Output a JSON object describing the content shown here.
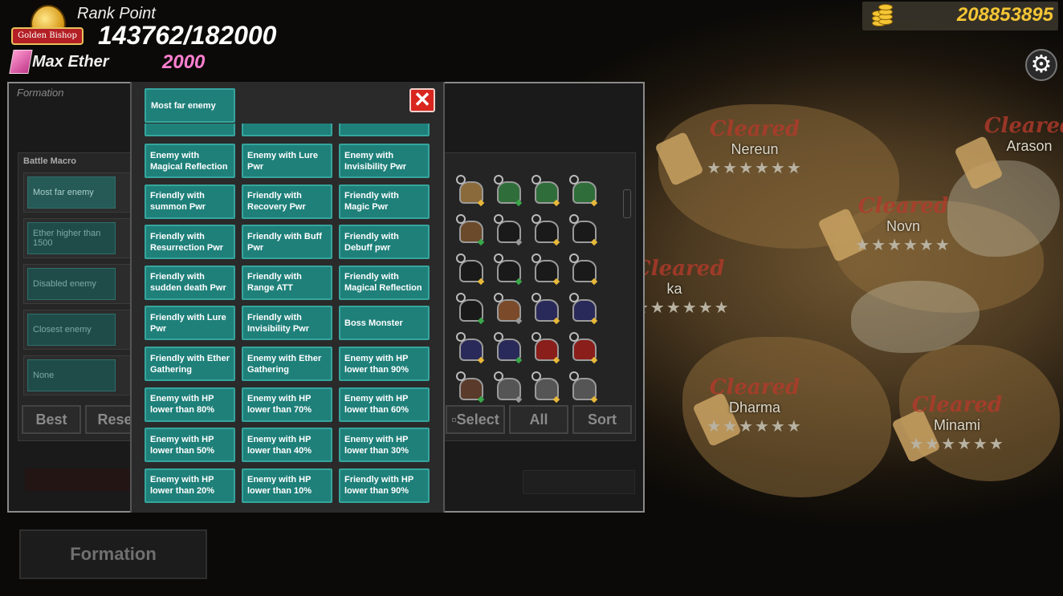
{
  "hud": {
    "badge_text": "Golden Bishop",
    "rank_label": "Rank Point",
    "rank_value": "143762/182000",
    "ether_label": "Max Ether",
    "ether_value": "2000",
    "gold_value": "208853895",
    "gold_icon": "gold-coins-icon",
    "settings_icon": "gear-icon"
  },
  "map": {
    "regions": [
      {
        "name": "Nereun",
        "status": "Cleared"
      },
      {
        "name": "Arason",
        "status": "Cleared"
      },
      {
        "name": "Novn",
        "status": "Cleared"
      },
      {
        "name": "ka",
        "status": "Cleared"
      },
      {
        "name": "Dharma",
        "status": "Cleared"
      },
      {
        "name": "Minami",
        "status": "Cleared"
      }
    ],
    "stars": "★★★★★★"
  },
  "panel": {
    "title": "Formation",
    "macro_title": "Battle Macro",
    "macros": [
      "Most far enemy",
      "Ether higher than 1500",
      "Disabled enemy",
      "Closest enemy",
      "None"
    ],
    "buttons": {
      "best": "Best",
      "reset": "Reset",
      "select": "Select",
      "all": "All",
      "sort": "Sort"
    },
    "formation_button": "Formation"
  },
  "popup": {
    "selected": "Most far enemy",
    "close_icon": "close-icon",
    "options": [
      "Enemy with Magical Reflection",
      "Enemy with Lure Pwr",
      "Enemy with Invisibility Pwr",
      "Friendly with summon Pwr",
      "Friendly with Recovery Pwr",
      "Friendly with Magic Pwr",
      "Friendly with Resurrection Pwr",
      "Friendly with Buff Pwr",
      "Friendly with Debuff pwr",
      "Friendly with sudden death Pwr",
      "Friendly with Range ATT",
      "Friendly with Magical Reflection",
      "Friendly with Lure Pwr",
      "Friendly with Invisibility Pwr",
      "Boss Monster",
      "Friendly with Ether Gathering",
      "Enemy with Ether Gathering",
      "Enemy with HP lower than 90%",
      "Enemy with HP lower than 80%",
      "Enemy with HP lower than 70%",
      "Enemy with HP lower than 60%",
      "Enemy with HP lower than 50%",
      "Enemy with HP lower than 40%",
      "Enemy with HP lower than 30%",
      "Enemy with HP lower than 20%",
      "Enemy with HP lower than 10%",
      "Friendly with HP lower than 90%"
    ]
  },
  "colors": {
    "option_bg": "#1f807a",
    "option_border": "#36a59d",
    "close_red": "#d8261f",
    "gold": "#f5c535",
    "ether_pink": "#ff7fd0",
    "cleared_red": "#b23a2b"
  }
}
